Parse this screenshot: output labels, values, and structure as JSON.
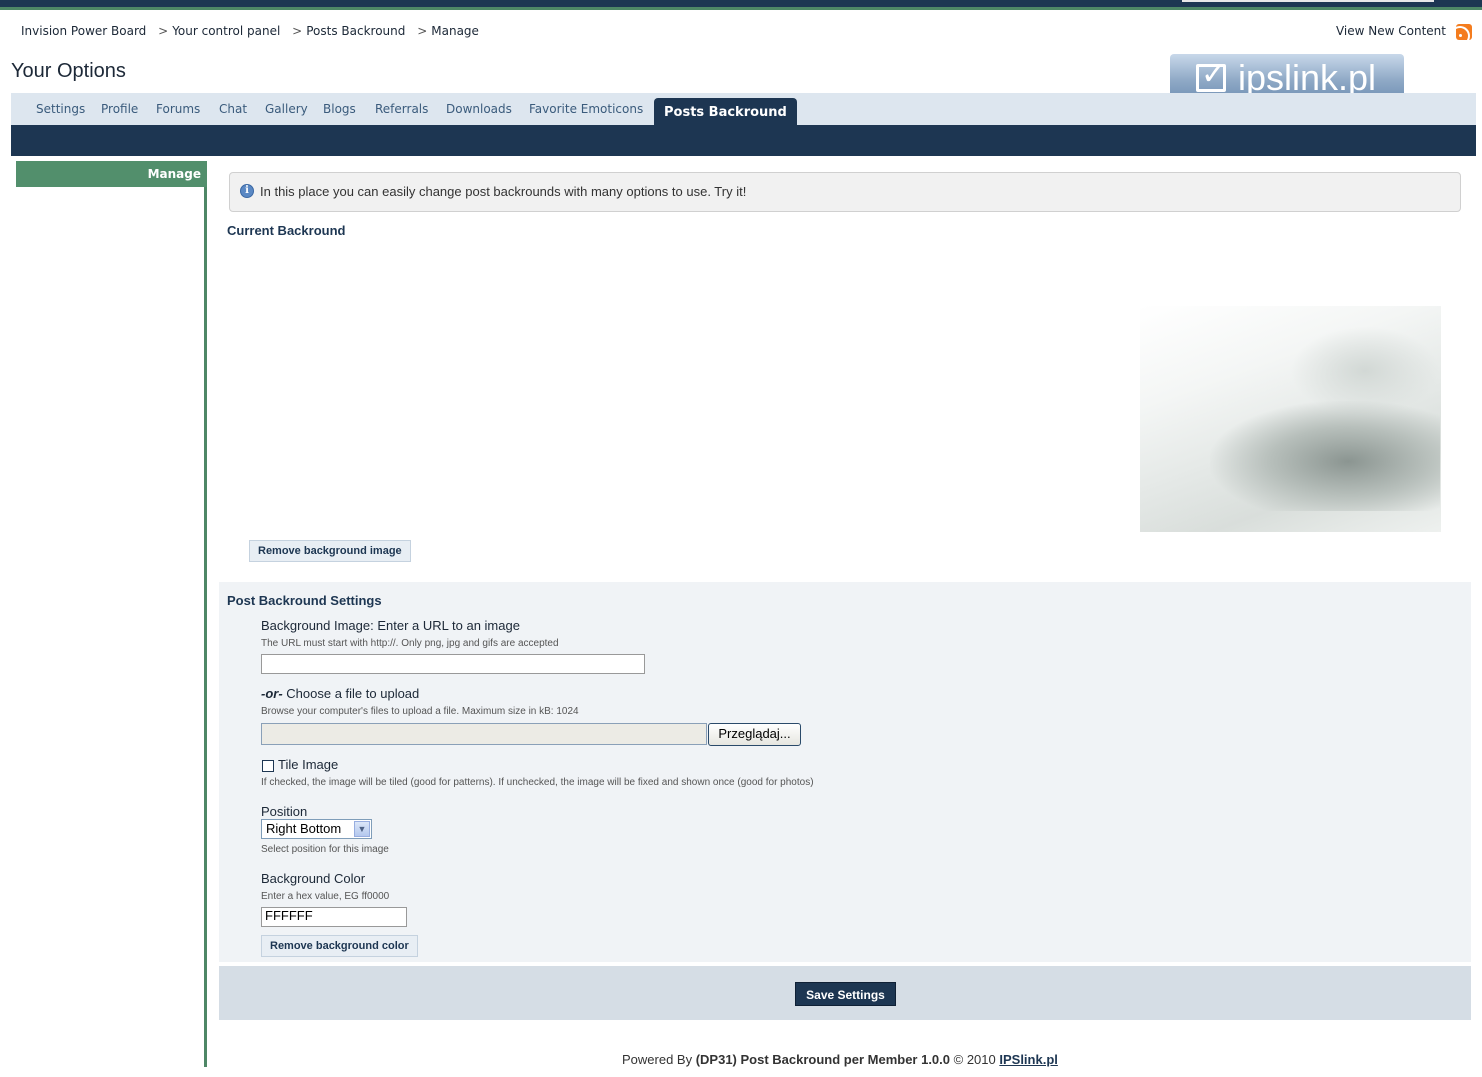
{
  "breadcrumb": {
    "items": [
      "Invision Power Board",
      "Your control panel",
      "Posts Backround",
      "Manage"
    ],
    "separator": ">"
  },
  "header": {
    "view_new_content": "View New Content",
    "rss_icon": "rss-icon",
    "page_title": "Your Options",
    "logo_text": "ipslink.pl"
  },
  "tabs": [
    {
      "label": "Settings"
    },
    {
      "label": "Profile"
    },
    {
      "label": "Forums"
    },
    {
      "label": "Chat"
    },
    {
      "label": "Gallery"
    },
    {
      "label": "Blogs"
    },
    {
      "label": "Referrals"
    },
    {
      "label": "Downloads"
    },
    {
      "label": "Favorite Emoticons"
    },
    {
      "label": "Posts Backround",
      "active": true
    }
  ],
  "sidebar": {
    "items": [
      {
        "label": "Manage",
        "active": true
      }
    ]
  },
  "info": {
    "icon": "info-icon",
    "message": "In this place you can easily change post backrounds with many options to use. Try it!"
  },
  "current": {
    "heading": "Current Backround",
    "remove_image_label": "Remove background image"
  },
  "settings": {
    "heading": "Post Backround Settings",
    "image_url": {
      "label": "Background Image: Enter a URL to an image",
      "desc": "The URL must start with http://. Only png, jpg and gifs are accepted",
      "value": ""
    },
    "upload": {
      "or": "-or-",
      "label": " Choose a file to upload",
      "desc": "Browse your computer's files to upload a file. Maximum size in kB: 1024",
      "browse_label": "Przeglądaj..."
    },
    "tile": {
      "label": "Tile Image",
      "checked": false,
      "desc": "If checked, the image will be tiled (good for patterns). If unchecked, the image will be fixed and shown once (good for photos)"
    },
    "position": {
      "label": "Position",
      "selected": "Right Bottom",
      "desc": "Select position for this image"
    },
    "bg_color": {
      "label": "Background Color",
      "desc": "Enter a hex value, EG ff0000",
      "value": "FFFFFF",
      "remove_label": "Remove background color"
    }
  },
  "save_label": "Save Settings",
  "footer": {
    "prefix": "Powered By ",
    "product": "(DP31) Post Backround per Member 1.0.0",
    "copyright": " © 2010 ",
    "link": "IPSlink.pl"
  },
  "colors": {
    "navy": "#1d3652",
    "green": "#528f6c",
    "tabbar": "#dde6ef"
  }
}
